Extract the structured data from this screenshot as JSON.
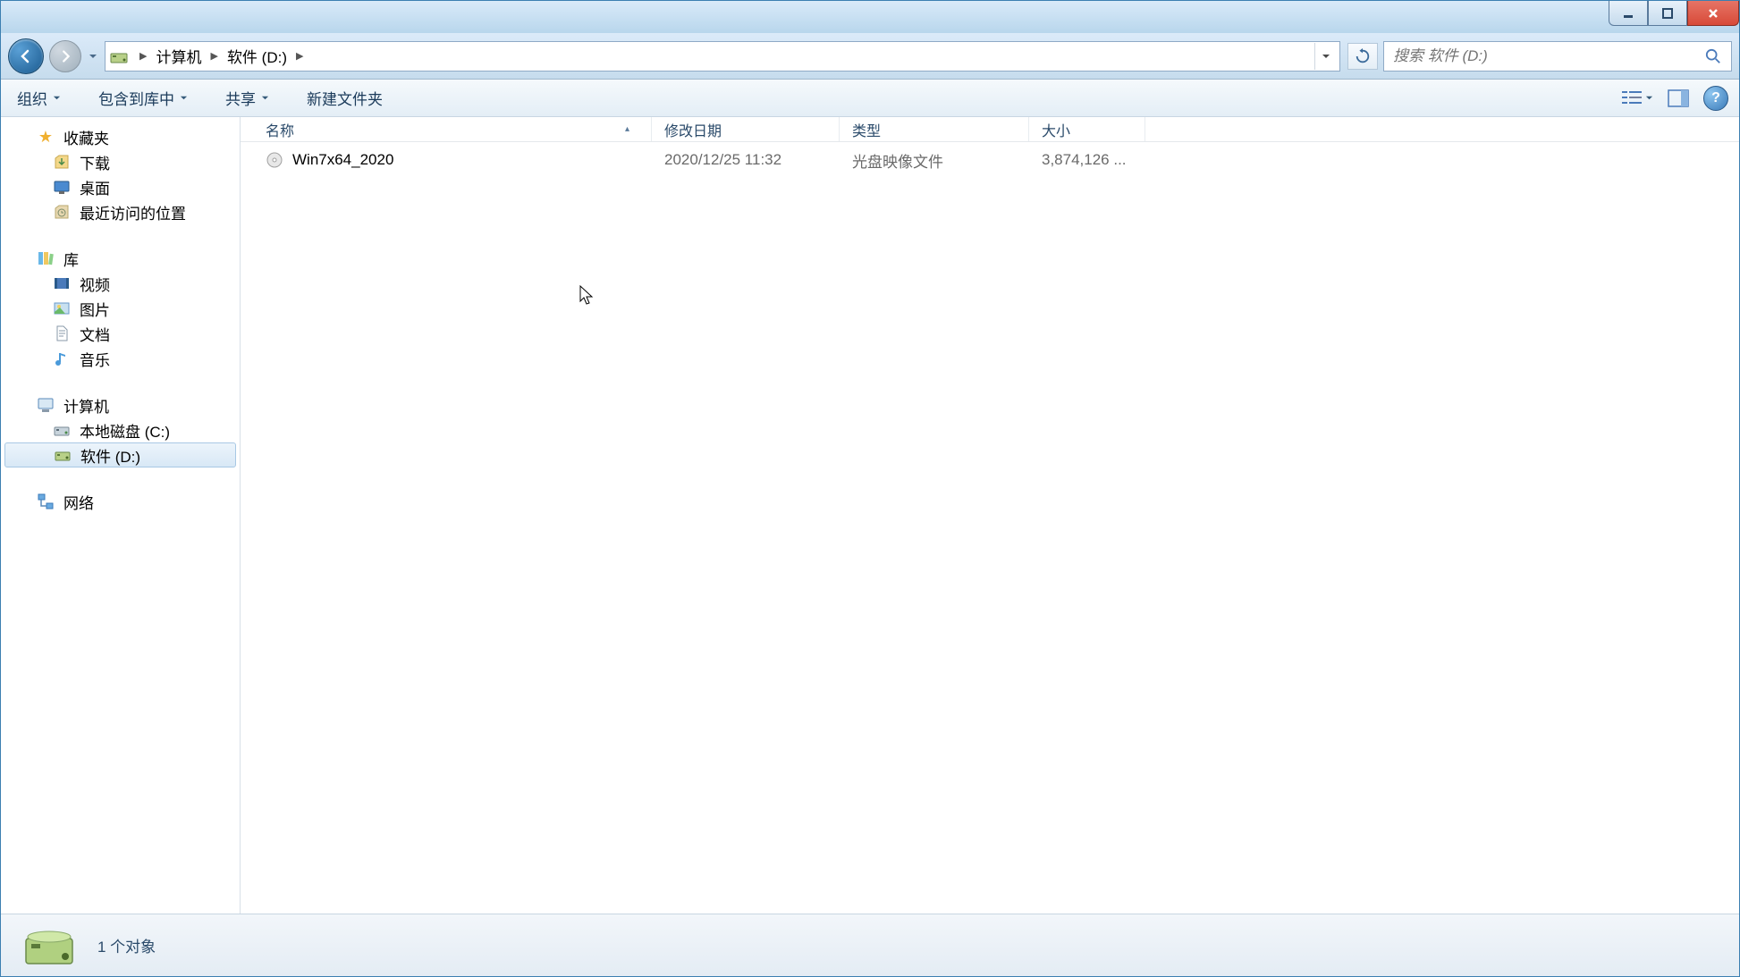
{
  "breadcrumbs": [
    "计算机",
    "软件 (D:)"
  ],
  "search": {
    "placeholder": "搜索 软件 (D:)"
  },
  "toolbar": {
    "organize": "组织",
    "include": "包含到库中",
    "share": "共享",
    "newFolder": "新建文件夹"
  },
  "columns": {
    "name": "名称",
    "date": "修改日期",
    "type": "类型",
    "size": "大小"
  },
  "sidebar": {
    "favorites": {
      "label": "收藏夹",
      "items": [
        "下载",
        "桌面",
        "最近访问的位置"
      ]
    },
    "libraries": {
      "label": "库",
      "items": [
        "视频",
        "图片",
        "文档",
        "音乐"
      ]
    },
    "computer": {
      "label": "计算机",
      "items": [
        "本地磁盘 (C:)",
        "软件 (D:)"
      ]
    },
    "network": {
      "label": "网络"
    }
  },
  "files": [
    {
      "name": "Win7x64_2020",
      "date": "2020/12/25 11:32",
      "type": "光盘映像文件",
      "size": "3,874,126 ..."
    }
  ],
  "status": {
    "text": "1 个对象"
  },
  "sidebarSelected": "软件 (D:)"
}
